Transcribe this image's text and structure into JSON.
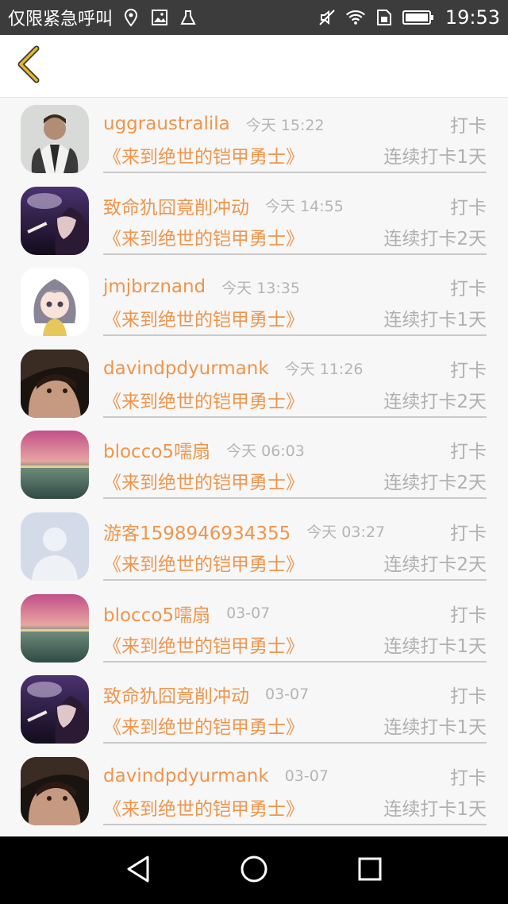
{
  "status_bar": {
    "carrier": "仅限紧急呼叫",
    "time": "19:53",
    "icons": [
      "location-icon",
      "image-icon",
      "storage-icon",
      "mute-icon",
      "wifi-icon",
      "sim-icon",
      "battery-icon"
    ]
  },
  "header": {
    "back_icon": "chevron-left-icon",
    "accent_color": "#e8b820"
  },
  "colors": {
    "username": "#f0954c",
    "meta": "#b0b0b0",
    "divider": "#c9c9c9"
  },
  "entries": [
    {
      "user": "uggraustralila",
      "time": "今天 15:22",
      "action": "打卡",
      "book": "《来到绝世的铠甲勇士》",
      "streak": "连续打卡1天",
      "avatar": "man-photo"
    },
    {
      "user": "致命犰囧竟削冲动",
      "time": "今天 14:55",
      "action": "打卡",
      "book": "《来到绝世的铠甲勇士》",
      "streak": "连续打卡2天",
      "avatar": "smoke-portrait"
    },
    {
      "user": "jmjbrznand",
      "time": "今天 13:35",
      "action": "打卡",
      "book": "《来到绝世的铠甲勇士》",
      "streak": "连续打卡1天",
      "avatar": "anime-girl"
    },
    {
      "user": "davindpdyurmank",
      "time": "今天 11:26",
      "action": "打卡",
      "book": "《来到绝世的铠甲勇士》",
      "streak": "连续打卡2天",
      "avatar": "dark-portrait"
    },
    {
      "user": "blocco5嚅扇",
      "time": "今天 06:03",
      "action": "打卡",
      "book": "《来到绝世的铠甲勇士》",
      "streak": "连续打卡2天",
      "avatar": "sunset-sea"
    },
    {
      "user": "游客1598946934355",
      "time": "今天 03:27",
      "action": "打卡",
      "book": "《来到绝世的铠甲勇士》",
      "streak": "连续打卡2天",
      "avatar": "default-silhouette"
    },
    {
      "user": "blocco5嚅扇",
      "time": "03-07",
      "action": "打卡",
      "book": "《来到绝世的铠甲勇士》",
      "streak": "连续打卡1天",
      "avatar": "sunset-sea"
    },
    {
      "user": "致命犰囧竟削冲动",
      "time": "03-07",
      "action": "打卡",
      "book": "《来到绝世的铠甲勇士》",
      "streak": "连续打卡1天",
      "avatar": "smoke-portrait"
    },
    {
      "user": "davindpdyurmank",
      "time": "03-07",
      "action": "打卡",
      "book": "《来到绝世的铠甲勇士》",
      "streak": "连续打卡1天",
      "avatar": "dark-portrait"
    }
  ],
  "nav_bar": {
    "icons": [
      "back-triangle-icon",
      "home-circle-icon",
      "recents-square-icon"
    ]
  }
}
